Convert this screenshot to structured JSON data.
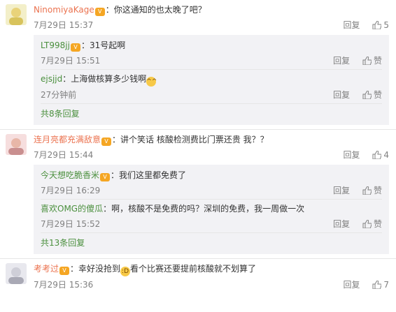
{
  "labels": {
    "reply": "回复",
    "like": "赞"
  },
  "comments": [
    {
      "user": "NinomiyaKage",
      "text": "：你这通知的也太晚了吧？",
      "time": "7月29日 15:37",
      "likes": "5",
      "replies": [
        {
          "user": "LT998jj",
          "text": "：31号起啊",
          "time": "7月29日 15:51",
          "likes": "赞"
        },
        {
          "user": "ejsjjd",
          "text": "：上海做核算多少钱啊",
          "time": "27分钟前",
          "likes": "赞"
        }
      ],
      "more": "共8条回复"
    },
    {
      "user": "连月亮都充满敌意",
      "text": "：讲个笑话 核酸检测费比门票还贵 我？？",
      "time": "7月29日 15:44",
      "likes": "4",
      "replies": [
        {
          "user": "今天想吃脆香米",
          "text": "：我们这里都免费了",
          "time": "7月29日 16:29",
          "likes": "赞"
        },
        {
          "user": "喜欢OMG的傻瓜",
          "text": "：啊，核酸不是免费的吗？深圳的免费，我一周做一次",
          "time": "7月29日 15:52",
          "likes": "赞"
        }
      ],
      "more": "共13条回复"
    },
    {
      "user": "考考过",
      "text": "：幸好没抢到",
      "text2": "看个比赛还要提前核酸就不划算了",
      "time": "7月29日 15:36",
      "likes": "7"
    }
  ]
}
